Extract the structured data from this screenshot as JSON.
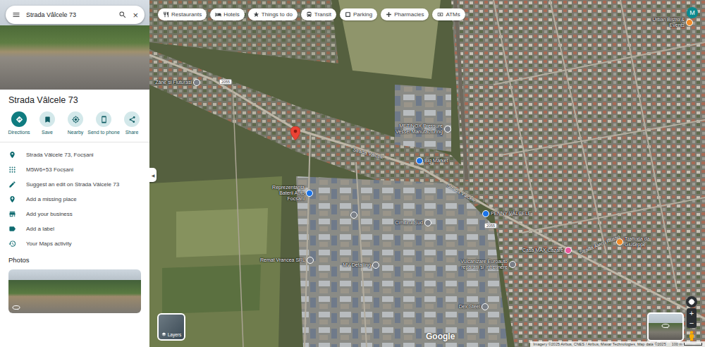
{
  "search": {
    "value": "Strada Vâlcele 73",
    "clear": "×"
  },
  "place": {
    "title": "Strada Vâlcele 73"
  },
  "actions": [
    {
      "label": "Directions",
      "primary": true
    },
    {
      "label": "Save",
      "primary": false
    },
    {
      "label": "Nearby",
      "primary": false
    },
    {
      "label": "Send to phone",
      "primary": false
    },
    {
      "label": "Share",
      "primary": false
    }
  ],
  "info": [
    {
      "kind": "address",
      "text": "Strada Vâlcele 73, Focșani"
    },
    {
      "kind": "pluscode",
      "text": "M5W6+53 Focșani"
    },
    {
      "kind": "edit",
      "text": "Suggest an edit on Strada Vâlcele 73"
    },
    {
      "kind": "addplace",
      "text": "Add a missing place"
    },
    {
      "kind": "business",
      "text": "Add your business"
    },
    {
      "kind": "label",
      "text": "Add a label"
    },
    {
      "kind": "activity",
      "text": "Your Maps activity"
    }
  ],
  "photos": {
    "heading": "Photos"
  },
  "collapse": "◀",
  "chips": [
    {
      "kind": "restaurants",
      "label": "Restaurants"
    },
    {
      "kind": "hotels",
      "label": "Hotels"
    },
    {
      "kind": "things",
      "label": "Things to do"
    },
    {
      "kind": "transit",
      "label": "Transit"
    },
    {
      "kind": "parking",
      "label": "Parking"
    },
    {
      "kind": "pharmacies",
      "label": "Pharmacies"
    },
    {
      "kind": "atms",
      "label": "ATMs"
    }
  ],
  "account": {
    "initial": "M"
  },
  "map_places": [
    {
      "text": "Zâne și Fluturași",
      "color": "#7a7f87"
    },
    {
      "text": "METINOX Pressure Vessel Manufacturing",
      "color": "#7a7f87"
    },
    {
      "text": "Big Market",
      "color": "#1a73e8"
    },
    {
      "text": "Reprezentanța Baterii Auto Focșani",
      "color": "#1a73e8"
    },
    {
      "text": "Cimitirul Sud",
      "color": "#7a7f87"
    },
    {
      "text": "PENNY VÂLCELE",
      "color": "#1a73e8"
    },
    {
      "text": "Casa MAX Cazare",
      "color": "#e8579b"
    },
    {
      "text": "Trattoria da Giuseppe",
      "color": "#f08c2a"
    },
    {
      "text": "Remat Vrancea SRL",
      "color": "#7a7f87"
    },
    {
      "text": "MV Detailing",
      "color": "#7a7f87"
    },
    {
      "text": "Vulcanizare Euroauto reparații și întreținere",
      "color": "#7a7f87"
    },
    {
      "text": "Dex Steel",
      "color": "#7a7f87"
    },
    {
      "text": "Urban Bistro & Events",
      "color": "#f08c2a"
    }
  ],
  "map_streets": [
    {
      "text": "Strada Vâlcele"
    },
    {
      "text": "Strada Vâlcele"
    },
    {
      "text": "Strada Alecu Russo"
    }
  ],
  "road_badges": [
    "2055",
    "2055"
  ],
  "layers": {
    "label": "Layers"
  },
  "zoom": {
    "in": "+",
    "out": "−"
  },
  "footer": {
    "logo": "Google",
    "attribution": "Imagery ©2025 Airbus, CNES / Airbus, Maxar Technologies, Map data ©2025",
    "scale": "100 m"
  }
}
